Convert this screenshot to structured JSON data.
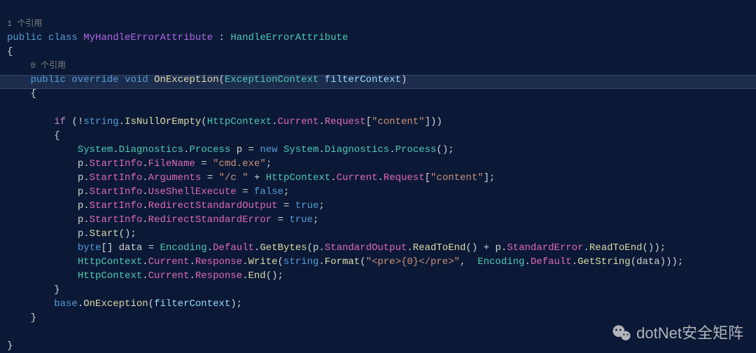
{
  "refs": {
    "class_ref": "1 个引用",
    "method_ref": "0 个引用"
  },
  "kw": {
    "public": "public",
    "class": "class",
    "override": "override",
    "void": "void",
    "if": "if",
    "new": "new",
    "false": "false",
    "true": "true",
    "byte": "byte",
    "string": "string",
    "base": "base"
  },
  "cls": {
    "MyHandleErrorAttribute": "MyHandleErrorAttribute",
    "HandleErrorAttribute": "HandleErrorAttribute",
    "OnException": "OnException",
    "ExceptionContext": "ExceptionContext",
    "filterContext": "filterContext",
    "HttpContext": "HttpContext",
    "System": "System",
    "Diagnostics": "Diagnostics",
    "Process": "Process",
    "Encoding": "Encoding"
  },
  "mem": {
    "IsNullOrEmpty": "IsNullOrEmpty",
    "Current": "Current",
    "Request": "Request",
    "StartInfo": "StartInfo",
    "FileName": "FileName",
    "Arguments": "Arguments",
    "UseShellExecute": "UseShellExecute",
    "RedirectStandardOutput": "RedirectStandardOutput",
    "RedirectStandardError": "RedirectStandardError",
    "Start": "Start",
    "Default": "Default",
    "GetBytes": "GetBytes",
    "StandardOutput": "StandardOutput",
    "ReadToEnd": "ReadToEnd",
    "StandardError": "StandardError",
    "Response": "Response",
    "Write": "Write",
    "Format": "Format",
    "GetString": "GetString",
    "End": "End"
  },
  "vars": {
    "p": "p",
    "data": "data"
  },
  "str": {
    "content": "\"content\"",
    "cmdexe": "\"cmd.exe\"",
    "slashc": "\"/c \"",
    "pre": "\"<pre>{0}</pre>\""
  },
  "watermark": "dotNet安全矩阵"
}
